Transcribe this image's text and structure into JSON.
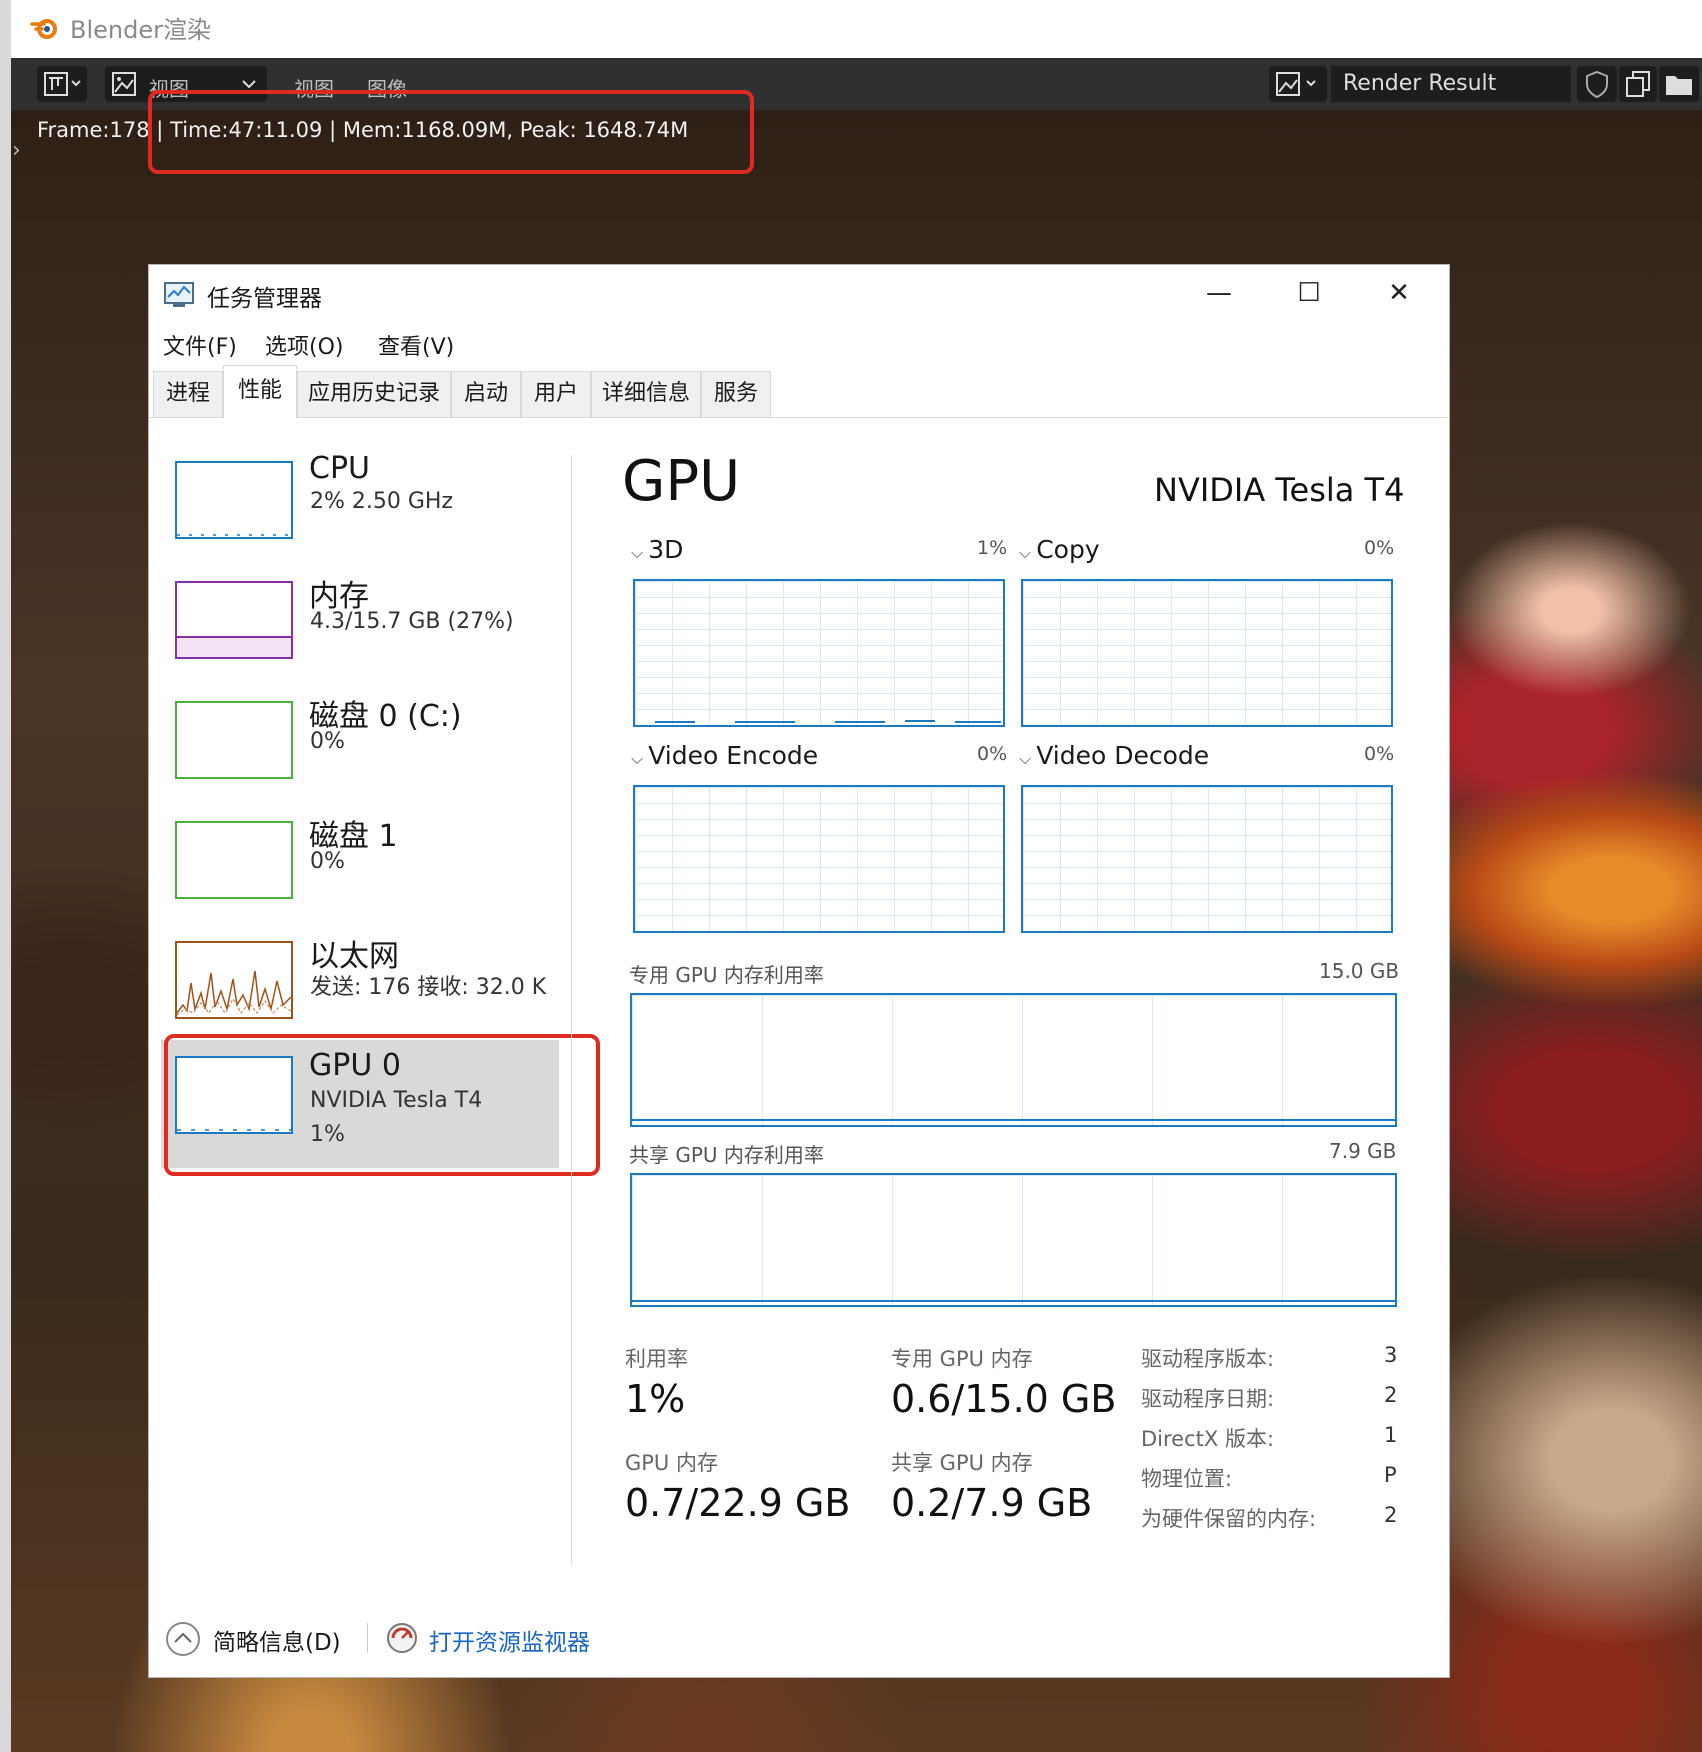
{
  "blender": {
    "window_title": "Blender渲染",
    "header": {
      "menu_view": "视图",
      "menu_view2": "视图",
      "menu_image": "图像",
      "render_result": "Render Result"
    },
    "stats": "Frame:178 | Time:47:11.09 | Mem:1168.09M, Peak: 1648.74M",
    "expand_arrow": "›"
  },
  "colors": {
    "highlight_box": "#e02a20",
    "cpu": "#1b7ac2",
    "memory": "#8b2fa8",
    "disk": "#4caf3c",
    "ethernet": "#a0521b",
    "gpu": "#1b7ac2",
    "link": "#1a66c9"
  },
  "taskmgr": {
    "title": "任务管理器",
    "controls": {
      "minimize": "—",
      "maximize": "☐",
      "close": "✕"
    },
    "menu": [
      "文件(F)",
      "选项(O)",
      "查看(V)"
    ],
    "tabs": [
      "进程",
      "性能",
      "应用历史记录",
      "启动",
      "用户",
      "详细信息",
      "服务"
    ],
    "active_tab": "性能",
    "sidebar": [
      {
        "name": "CPU",
        "line2": "2% 2.50 GHz",
        "line3": ""
      },
      {
        "name": "内存",
        "line2": "4.3/15.7 GB (27%)",
        "line3": ""
      },
      {
        "name": "磁盘 0 (C:)",
        "line2": "0%",
        "line3": ""
      },
      {
        "name": "磁盘 1",
        "line2": "0%",
        "line3": ""
      },
      {
        "name": "以太网",
        "line2": "发送: 176 接收: 32.0 K",
        "line3": ""
      },
      {
        "name": "GPU 0",
        "line2": "NVIDIA Tesla T4",
        "line3": "1%"
      }
    ],
    "gpu": {
      "title": "GPU",
      "model": "NVIDIA Tesla T4",
      "engines": [
        {
          "label": "3D",
          "pct": "1%"
        },
        {
          "label": "Copy",
          "pct": "0%"
        },
        {
          "label": "Video Encode",
          "pct": "0%"
        },
        {
          "label": "Video Decode",
          "pct": "0%"
        }
      ],
      "dedicated_label": "专用 GPU 内存利用率",
      "dedicated_max": "15.0 GB",
      "shared_label": "共享 GPU 内存利用率",
      "shared_max": "7.9 GB",
      "stats": {
        "util_label": "利用率",
        "util_value": "1%",
        "dedicated_label": "专用 GPU 内存",
        "dedicated_value": "0.6/15.0 GB",
        "gpu_mem_label": "GPU 内存",
        "gpu_mem_value": "0.7/22.9 GB",
        "shared_label": "共享 GPU 内存",
        "shared_value": "0.2/7.9 GB"
      },
      "details": [
        {
          "k": "驱动程序版本:",
          "v": "3"
        },
        {
          "k": "驱动程序日期:",
          "v": "2"
        },
        {
          "k": "DirectX 版本:",
          "v": "1"
        },
        {
          "k": "物理位置:",
          "v": "P"
        },
        {
          "k": "为硬件保留的内存:",
          "v": "2"
        }
      ]
    },
    "footer": {
      "brief": "简略信息(D)",
      "open_monitor": "打开资源监视器"
    }
  }
}
